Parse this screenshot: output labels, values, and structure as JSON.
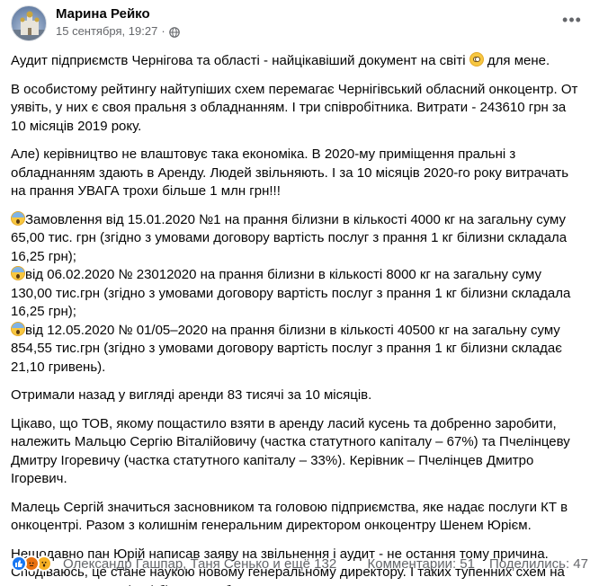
{
  "author": {
    "name": "Марина Рейко",
    "date": "15 сентября, 19:27",
    "separator": "·"
  },
  "post": {
    "p1_text": "Аудит підприємств Чернігова та області - найцікавіший документ на світі",
    "p1_suffix": " для мене.",
    "p2": "В особистому рейтингу найтупіших схем перемагає Чернігівський обласний онкоцентр. От уявіть, у них є своя пральня з обладнанням. І три співробітника. Витрати - 243610 грн за 10 місяців 2019 року.",
    "p3": "Але) керівництво не влаштовує така економіка. В 2020-му приміщення пральні з обладнанням здають в Аренду. Людей звільняють. І за 10 місяців 2020-го року витрачать на прання УВАГА трохи більше 1 млн грн!!!",
    "list": [
      "Замовлення від 15.01.2020 №1 на прання білизни в кількості 4000 кг на загальну суму 65,00 тис. грн (згідно з умовами договору вартість послуг з прання 1 кг білизни складала 16,25 грн);",
      "від 06.02.2020 № 23012020 на прання білизни в кількості 8000 кг на загальну суму 130,00 тис.грн (згідно з умовами договору вартість послуг з прання 1 кг білизни складала 16,25 грн);",
      "від 12.05.2020 № 01/05–2020 на прання білизни в кількості 40500 кг на загальну суму 854,55 тис.грн (згідно з умовами договору вартість послуг з прання 1 кг білизни складає 21,10 гривень)."
    ],
    "p5": "Отримали назад у вигляді аренди 83 тисячі за 10 місяців.",
    "p6": "Цікаво, що ТОВ, якому пощастило взяти в аренду ласий кусень та добренно заробити, належить Мальцю Сергію Віталійовичу (частка статутного капіталу – 67%) та Пчелінцеву Дмитру Ігоревичу (частка статутного капіталу – 33%). Керівник – Пчелінцев Дмитро Ігоревич.",
    "p7": "Малець Сергій значиться засновником та головою підприємства, яке надає послуги КТ в онкоцентрі. Разом з колишнім генеральним директором онкоцентру Шенем Юрієм.",
    "p8": "Нещодавно пан Юрій написав заяву на звільнення і аудит - не остання тому причина. Сподіваюсь, це стане наукою новому генеральному директору. І таких тупенних схем на онкохворих в Чернігові більше не буде."
  },
  "footer": {
    "reacted_by": "Олександр Гашпар, Таня Сенько и ещё 132",
    "comments": "Комментарии: 51",
    "shares": "Поделились: 47"
  },
  "icons": {
    "more": "more-horizontal-icon",
    "globe": "globe-icon",
    "like": "like-reaction-icon",
    "angry": "angry-reaction-icon",
    "wow": "wow-reaction-icon"
  },
  "colors": {
    "text": "#050505",
    "secondary": "#65676b",
    "like": "#1877f2"
  }
}
